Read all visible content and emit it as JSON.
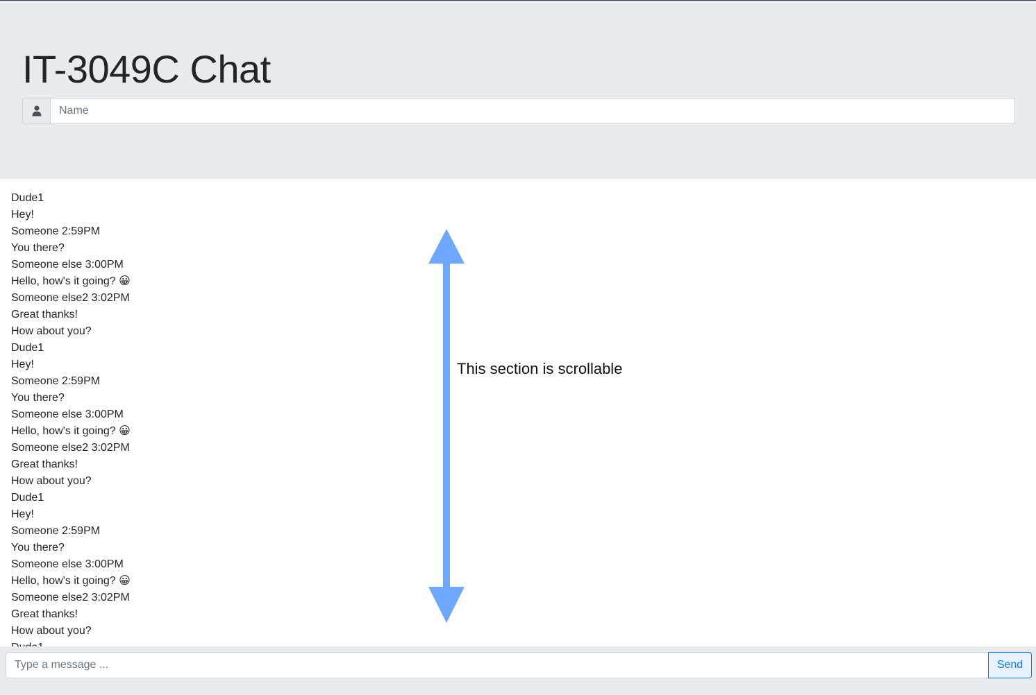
{
  "header": {
    "title": "IT-3049C Chat",
    "name_placeholder": "Name",
    "name_value": "",
    "user_icon": "user-icon"
  },
  "messages": {
    "lines": [
      "Dude1",
      "Hey!",
      "Someone 2:59PM",
      "You there?",
      "Someone else 3:00PM",
      "Hello, how's it going? 😀",
      "Someone else2 3:02PM",
      "Great thanks!",
      "How about you?",
      "Dude1",
      "Hey!",
      "Someone 2:59PM",
      "You there?",
      "Someone else 3:00PM",
      "Hello, how's it going? 😀",
      "Someone else2 3:02PM",
      "Great thanks!",
      "How about you?",
      "Dude1",
      "Hey!",
      "Someone 2:59PM",
      "You there?",
      "Someone else 3:00PM",
      "Hello, how's it going? 😀",
      "Someone else2 3:02PM",
      "Great thanks!",
      "How about you?",
      "Dude1"
    ]
  },
  "annotation": {
    "text": "This section is scrollable",
    "arrow_icon": "double-arrow-icon",
    "arrow_color": "#6ea8fe"
  },
  "footer": {
    "message_placeholder": "Type a message ...",
    "message_value": "",
    "send_label": "Send"
  },
  "colors": {
    "panel_background": "#e9ecef",
    "primary": "#007bff"
  }
}
